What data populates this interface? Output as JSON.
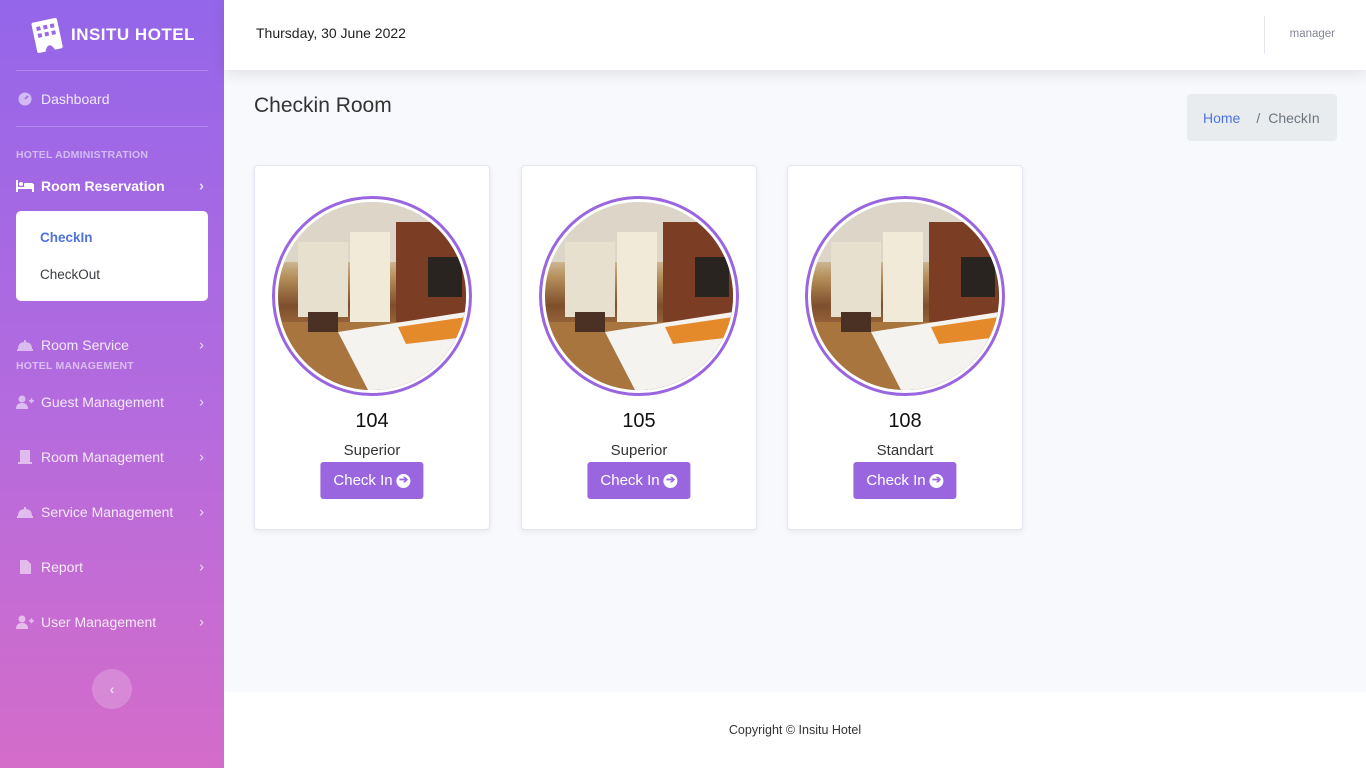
{
  "brand": {
    "name": "INSITU HOTEL"
  },
  "sidebar": {
    "dashboard": "Dashboard",
    "heading_admin": "HOTEL ADMINISTRATION",
    "room_reservation": "Room Reservation",
    "submenu": [
      "CheckIn",
      "CheckOut"
    ],
    "room_service": "Room Service",
    "heading_management": "HOTEL MANAGEMENT",
    "guest_management": "Guest Management",
    "room_management": "Room Management",
    "service_management": "Service Management",
    "report": "Report",
    "user_management": "User Management"
  },
  "topbar": {
    "date": "Thursday, 30 June 2022",
    "user": "manager"
  },
  "page": {
    "title": "Checkin Room"
  },
  "breadcrumb": {
    "home": "Home",
    "separator": "/",
    "current": "CheckIn"
  },
  "rooms": [
    {
      "number": "104",
      "type": "Superior",
      "button": "Check In"
    },
    {
      "number": "105",
      "type": "Superior",
      "button": "Check In"
    },
    {
      "number": "108",
      "type": "Standart",
      "button": "Check In"
    }
  ],
  "footer": {
    "copyright": "Copyright © Insitu Hotel"
  },
  "colors": {
    "accent": "#9966e0",
    "link": "#4e73df",
    "sidebar_top": "#9466ea",
    "sidebar_bottom": "#d46cc9"
  }
}
